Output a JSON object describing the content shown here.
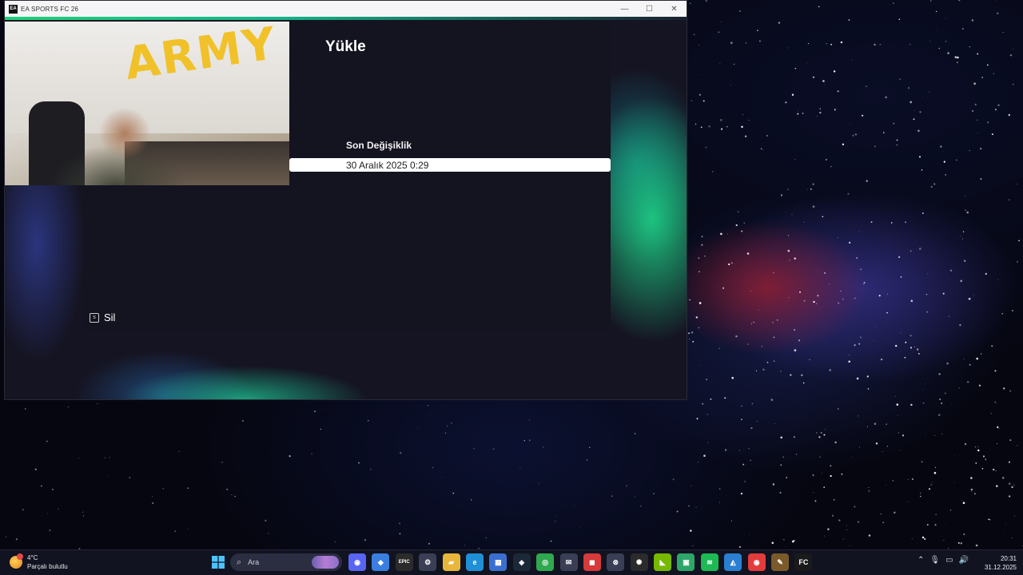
{
  "window": {
    "title": "EA SPORTS FC 26",
    "app_icon_text": "EA",
    "controls": {
      "minimize": "—",
      "maximize": "☐",
      "close": "✕"
    }
  },
  "webcam": {
    "wall_text": "ARMY"
  },
  "game": {
    "page_title": "Yükle",
    "column_header": "Son Değişiklik",
    "saves": [
      "30 Aralık 2025 0:29"
    ],
    "delete_hint": {
      "key": "s",
      "label": "Sil"
    }
  },
  "taskbar": {
    "weather": {
      "temp": "4°C",
      "condition": "Parçalı bulutlu"
    },
    "search_placeholder": "Ara",
    "apps": [
      {
        "name": "discord-icon",
        "glyph": "◉",
        "color": "#5865f2"
      },
      {
        "name": "copilot-icon",
        "glyph": "◆",
        "color": "#3a7ee0"
      },
      {
        "name": "epic-games-icon",
        "glyph": "EPIC",
        "color": "#2b2b2b"
      },
      {
        "name": "settings-icon",
        "glyph": "⚙",
        "color": "#3a3f55"
      },
      {
        "name": "file-explorer-icon",
        "glyph": "▰",
        "color": "#e8b63a"
      },
      {
        "name": "edge-icon",
        "glyph": "e",
        "color": "#1f8fd6"
      },
      {
        "name": "store-icon",
        "glyph": "▦",
        "color": "#3a6fd0"
      },
      {
        "name": "steam-icon",
        "glyph": "◈",
        "color": "#1b2838"
      },
      {
        "name": "chrome-icon",
        "glyph": "◎",
        "color": "#2fa84f"
      },
      {
        "name": "mail-icon",
        "glyph": "✉",
        "color": "#3a3f55"
      },
      {
        "name": "app-red-icon",
        "glyph": "◼",
        "color": "#d63a3a"
      },
      {
        "name": "xbox-icon",
        "glyph": "⊗",
        "color": "#3a3f55"
      },
      {
        "name": "chatgpt-icon",
        "glyph": "✺",
        "color": "#2b2b2b"
      },
      {
        "name": "nvidia-icon",
        "glyph": "◣",
        "color": "#76b900"
      },
      {
        "name": "android-icon",
        "glyph": "▣",
        "color": "#2ea66a"
      },
      {
        "name": "spotify-icon",
        "glyph": "≋",
        "color": "#1db954"
      },
      {
        "name": "photos-icon",
        "glyph": "◭",
        "color": "#2a7fd0"
      },
      {
        "name": "ea-app-icon",
        "glyph": "◉",
        "color": "#e23c3c"
      },
      {
        "name": "game-tool-icon",
        "glyph": "✎",
        "color": "#7a5a2a"
      },
      {
        "name": "fc-icon",
        "glyph": "FC",
        "color": "#1a1a1a"
      }
    ],
    "clock": {
      "time": "20:31",
      "date": "31.12.2025"
    }
  }
}
